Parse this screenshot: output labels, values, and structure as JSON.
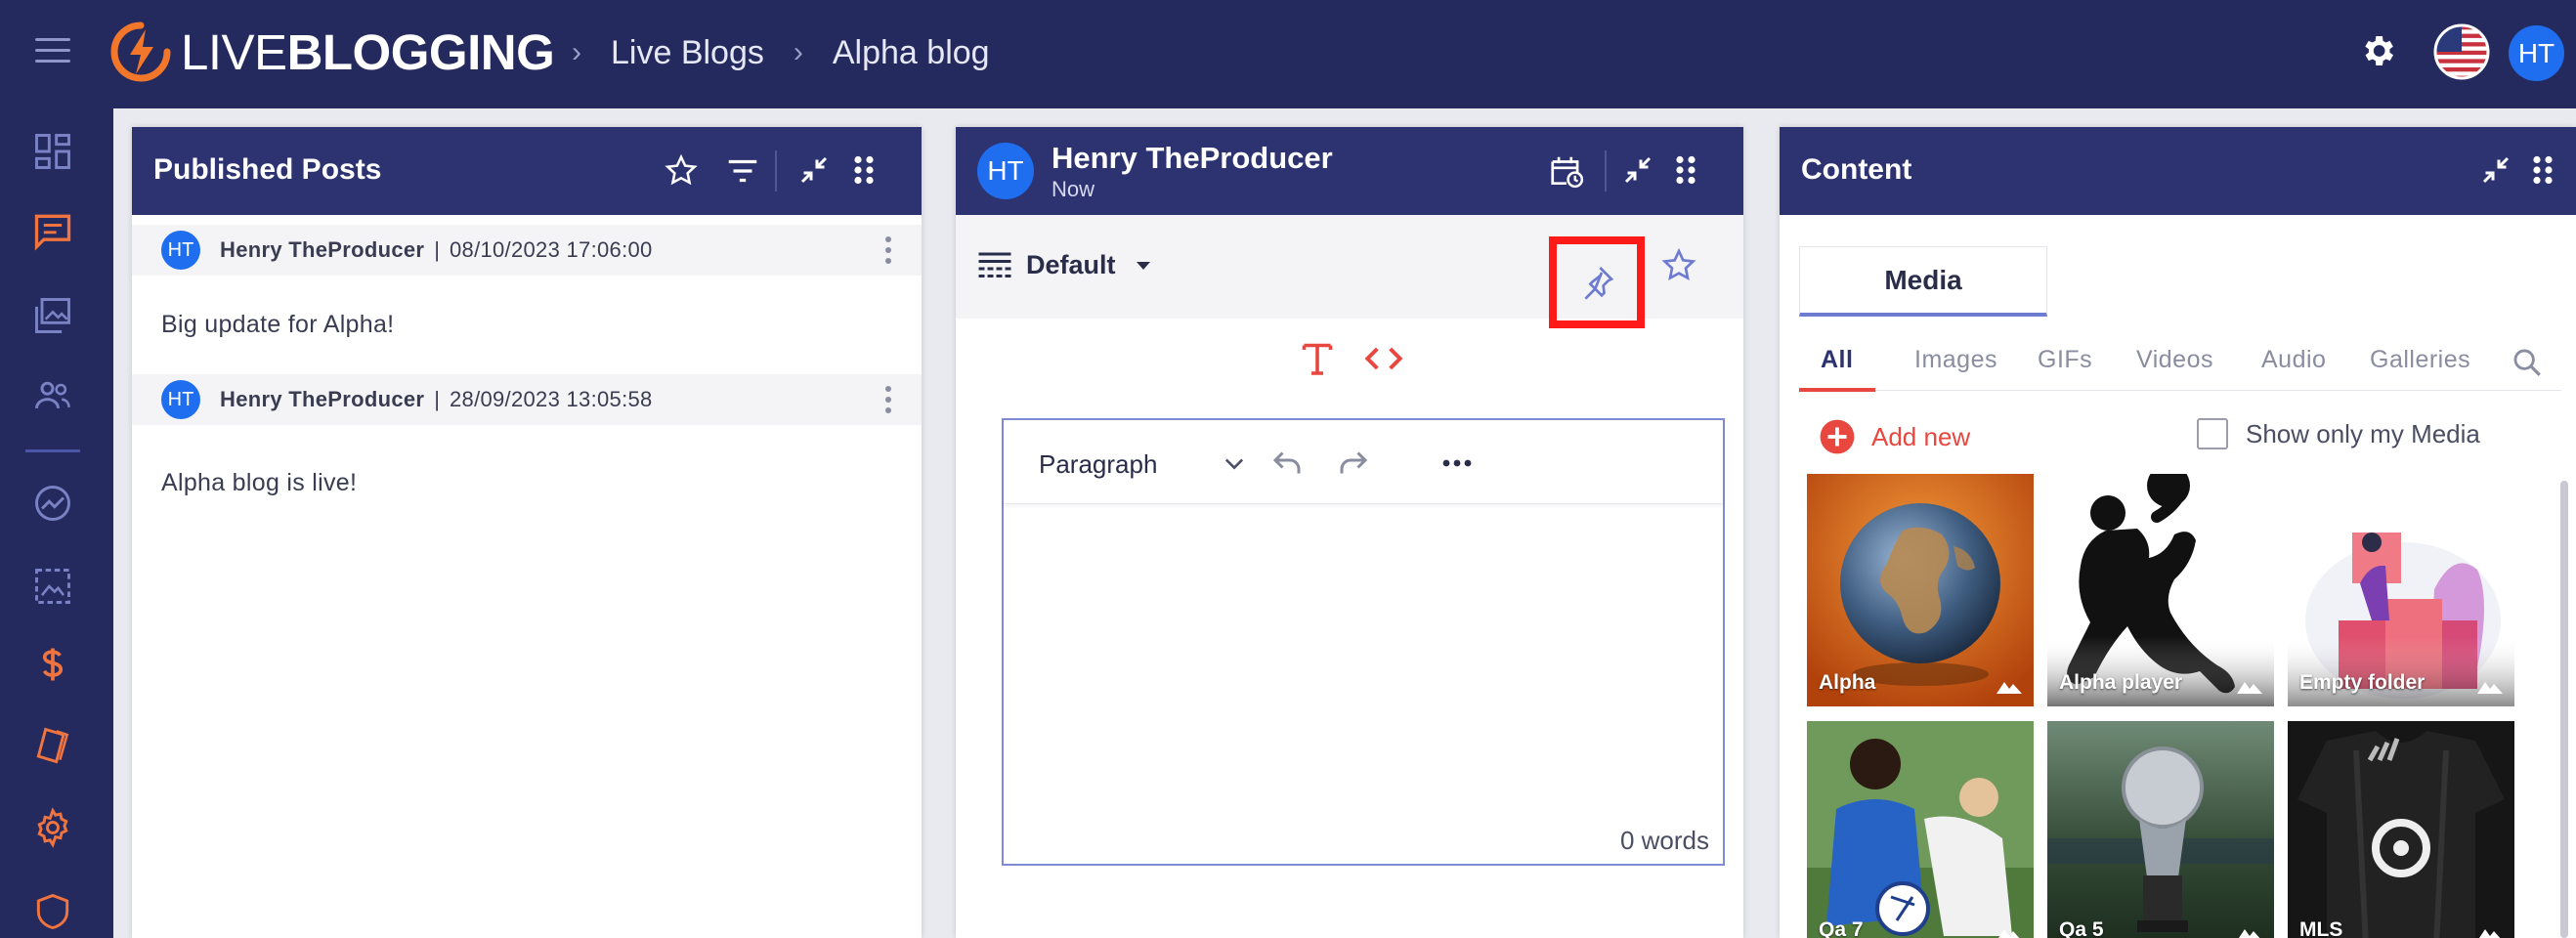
{
  "app": {
    "brand_light": "LIVE",
    "brand_bold": "BLOGGING",
    "breadcrumbs": [
      "Live Blogs",
      "Alpha blog"
    ],
    "user_initials": "HT"
  },
  "published": {
    "title": "Published Posts",
    "posts": [
      {
        "initials": "HT",
        "author": "Henry TheProducer",
        "date": "08/10/2023 17:06:00",
        "body": "Big update for Alpha!"
      },
      {
        "initials": "HT",
        "author": "Henry TheProducer",
        "date": "28/09/2023 13:05:58",
        "body": "Alpha blog is live!"
      }
    ]
  },
  "editor": {
    "initials": "HT",
    "author": "Henry TheProducer",
    "time": "Now",
    "template": "Default",
    "block_type": "Paragraph",
    "word_count": "0 words"
  },
  "content": {
    "title": "Content",
    "tab": "Media",
    "subtabs": [
      "All",
      "Images",
      "GIFs",
      "Videos",
      "Audio",
      "Galleries"
    ],
    "add_new": "Add new",
    "only_mine": "Show only my Media",
    "media": [
      {
        "label": "Alpha"
      },
      {
        "label": "Alpha player"
      },
      {
        "label": "Empty folder"
      },
      {
        "label": "Qa 7"
      },
      {
        "label": "Qa 5"
      },
      {
        "label": "MLS"
      }
    ]
  },
  "colors": {
    "nav_bg": "#252a5e",
    "panel_header": "#2d3371",
    "accent_red": "#e8473f",
    "avatar_blue": "#1f6ef0",
    "highlight": "#ff1a1a"
  }
}
